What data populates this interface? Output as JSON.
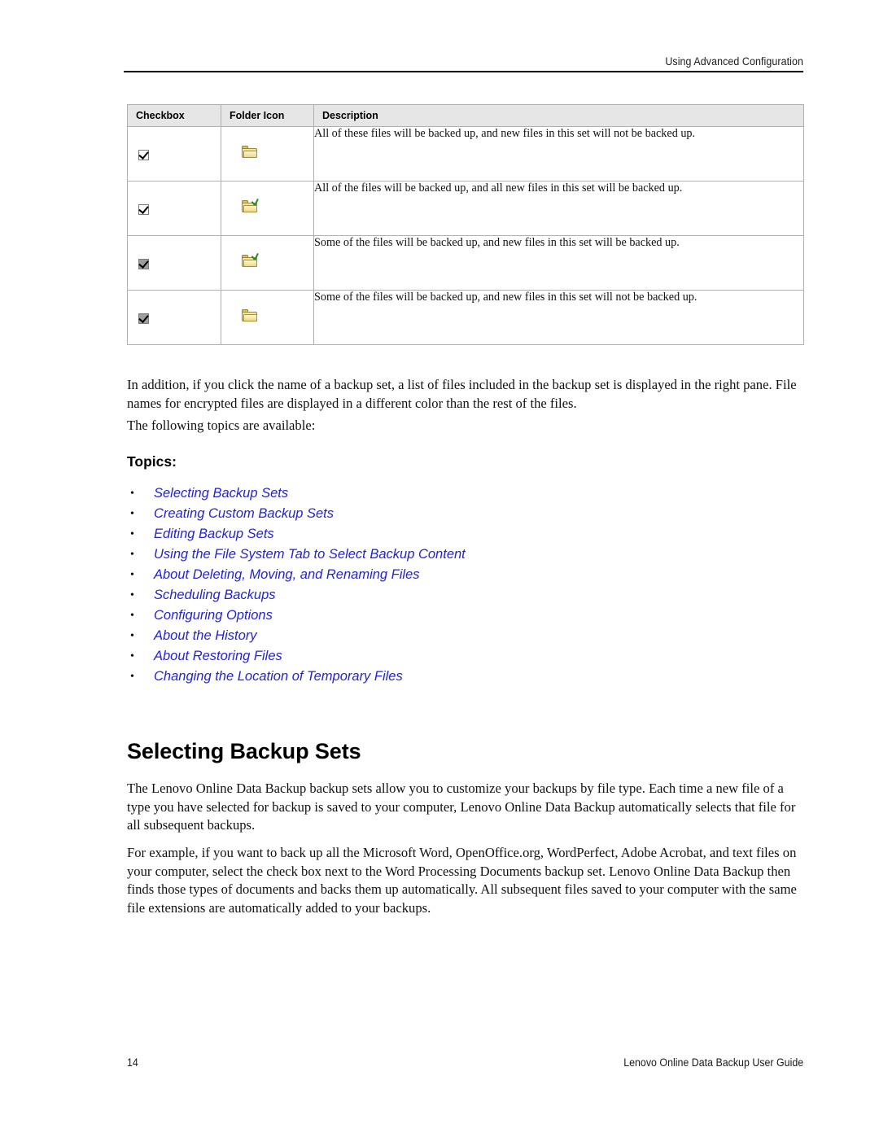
{
  "header": {
    "running_title": "Using Advanced Configuration"
  },
  "table": {
    "columns": [
      "Checkbox",
      "Folder Icon",
      "Description"
    ],
    "rows": [
      {
        "checkbox_state": "checked",
        "folder_icon": "folder-icon",
        "description": "All of these files will be backed up, and new files in this set will not be backed up."
      },
      {
        "checkbox_state": "checked",
        "folder_icon": "folder-checked-icon",
        "description": "All of the files will be backed up, and all new files in this set will be backed up."
      },
      {
        "checkbox_state": "partial",
        "folder_icon": "folder-checked-icon",
        "description": "Some of the files will be backed up, and new files in this set will be backed up."
      },
      {
        "checkbox_state": "partial",
        "folder_icon": "folder-icon",
        "description": "Some of the files will be backed up, and new files in this set will not be backed up."
      }
    ]
  },
  "body": {
    "intro_paragraph": "In addition, if you click the name of a backup set, a list of files included in the backup set is displayed in the right pane. File names for encrypted files are displayed in a different color than the rest of the files.",
    "following_topics_line": "The following topics are available:",
    "topics_label": "Topics:",
    "topics": [
      "Selecting Backup Sets",
      "Creating Custom Backup Sets",
      "Editing Backup Sets",
      "Using the File System Tab to Select Backup Content",
      "About Deleting, Moving, and Renaming Files",
      "Scheduling Backups",
      "Configuring Options",
      "About the History",
      "About Restoring Files",
      "Changing the Location of Temporary Files"
    ],
    "bullet_glyph": "•",
    "section_heading": "Selecting Backup Sets",
    "paragraph_1": "The Lenovo Online Data Backup backup sets allow you to customize your backups by file type. Each time a new file of a type you have selected for backup is saved to your computer, Lenovo Online Data Backup automatically selects that file for all subsequent backups.",
    "paragraph_2": "For example, if you want to back up all the Microsoft Word, OpenOffice.org, WordPerfect, Adobe Acrobat, and text files on your computer, select the check box next to the Word Processing Documents backup set. Lenovo Online Data Backup then finds those types of documents and backs them up automatically. All subsequent files saved to your computer with the same file extensions are automatically added to your backups."
  },
  "footer": {
    "page_number": "14",
    "guide_title": "Lenovo Online Data Backup User Guide"
  },
  "colors": {
    "link": "#2323d6",
    "table_header_bg": "#e6e6e6",
    "table_border": "#b0b0b0",
    "folder_yellow": "#e2cd74",
    "check_green": "#2f8a23"
  }
}
